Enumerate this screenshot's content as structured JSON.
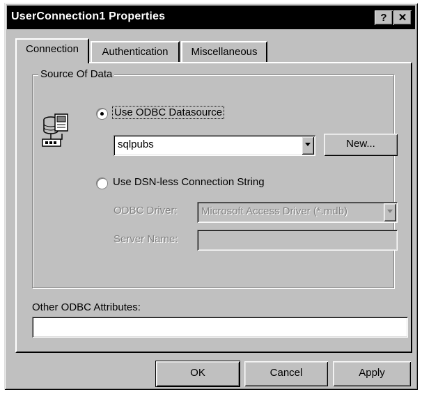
{
  "window": {
    "title": "UserConnection1 Properties",
    "help_label": "?",
    "close_label": "✕"
  },
  "tabs": [
    {
      "label": "Connection",
      "active": true
    },
    {
      "label": "Authentication",
      "active": false
    },
    {
      "label": "Miscellaneous",
      "active": false
    }
  ],
  "source_group": {
    "title": "Source Of Data",
    "odbc_radio_label": "Use ODBC Datasource",
    "odbc_radio_checked": true,
    "datasource_value": "sqlpubs",
    "new_button_label": "New...",
    "dsnless_radio_label": "Use DSN-less Connection String",
    "odbc_driver_label": "ODBC Driver:",
    "odbc_driver_value": "Microsoft Access Driver (*.mdb)",
    "server_name_label": "Server Name:",
    "server_name_value": ""
  },
  "other_attributes": {
    "label": "Other ODBC Attributes:",
    "value": ""
  },
  "footer": {
    "ok_label": "OK",
    "cancel_label": "Cancel",
    "apply_label": "Apply"
  },
  "icons": {
    "datasource": "database-server-icon"
  }
}
